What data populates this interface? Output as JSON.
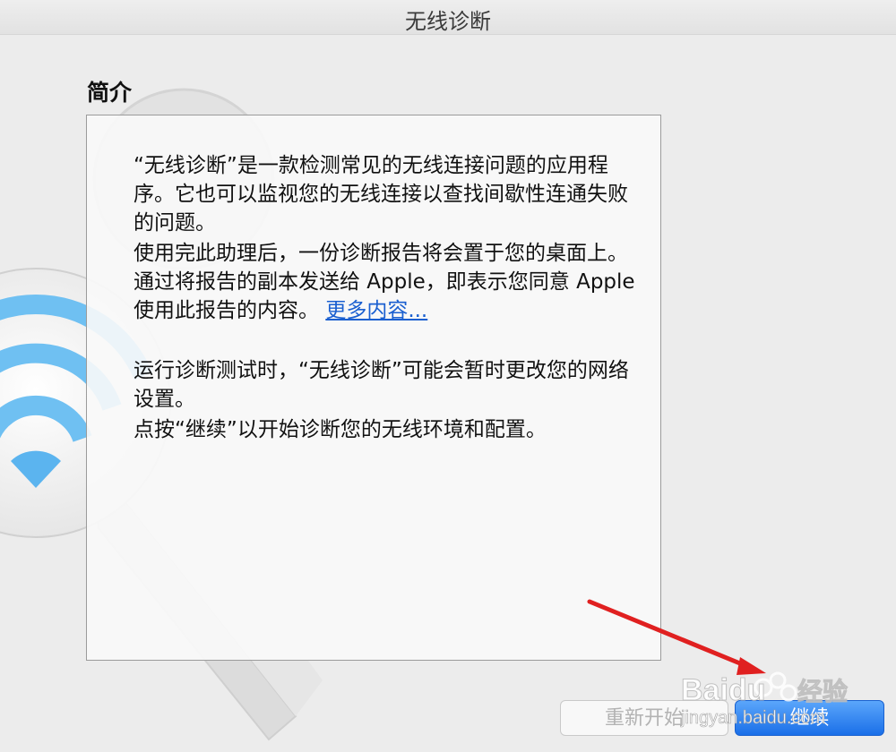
{
  "window": {
    "title": "无线诊断"
  },
  "section": {
    "title": "简介"
  },
  "content": {
    "p1": "“无线诊断”是一款检测常见的无线连接问题的应用程序。它也可以监视您的无线连接以查找间歇性连通失败的问题。",
    "p2_text": "使用完此助理后，一份诊断报告将会置于您的桌面上。通过将报告的副本发送给 Apple，即表示您同意 Apple 使用此报告的内容。",
    "p2_link": "更多内容...",
    "p3": "运行诊断测试时，“无线诊断”可能会暂时更改您的网络设置。",
    "p4": "点按“继续”以开始诊断您的无线环境和配置。"
  },
  "buttons": {
    "restart": "重新开始",
    "continue": "继续"
  },
  "watermark": {
    "brand": "Baidu",
    "suffix": "经验",
    "url": "jingyan.baidu.com"
  },
  "icons": {
    "background": "wireless-diagnostics-wifi-icon",
    "tool": "screwdriver-icon"
  },
  "colors": {
    "link": "#1a5fd0",
    "primary_button": "#2b7ff0",
    "annotation_arrow": "#e02020"
  }
}
